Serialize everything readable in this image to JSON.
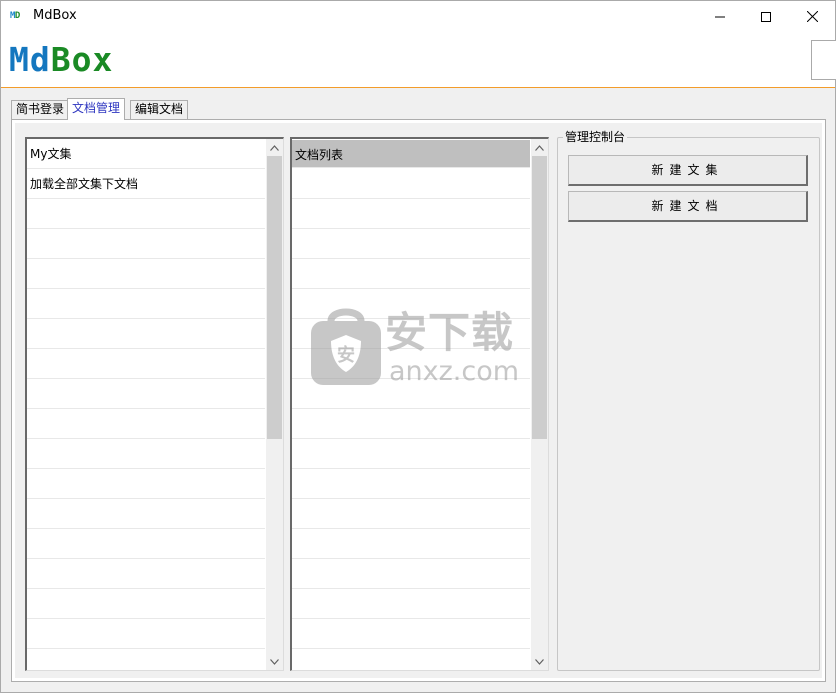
{
  "window": {
    "icon_text_m": "M",
    "icon_text_d": "D",
    "title": "MdBox"
  },
  "header": {
    "logo_part1": "Md",
    "logo_part2": "Box"
  },
  "tabs": [
    {
      "label": "简书登录",
      "active": false
    },
    {
      "label": "文档管理",
      "active": true
    },
    {
      "label": "编辑文档",
      "active": false
    }
  ],
  "collections_list": {
    "items": [
      "My文集",
      "加载全部文集下文档"
    ]
  },
  "documents_list": {
    "header": "文档列表",
    "items": []
  },
  "control_panel": {
    "title": "管理控制台",
    "new_collection_label": "新建文集",
    "new_document_label": "新建文档"
  },
  "watermark": {
    "cn": "安下载",
    "en": "anxz.com"
  },
  "colors": {
    "accent_orange": "#f39c2a",
    "logo_blue": "#1477bf",
    "logo_green": "#1a8a25",
    "active_tab_text": "#2e36c0"
  }
}
